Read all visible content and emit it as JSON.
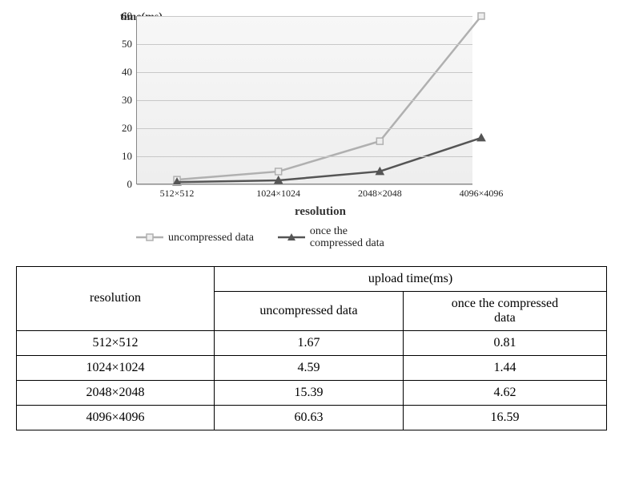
{
  "chart_data": {
    "type": "line",
    "title": "",
    "xlabel": "resolution",
    "ylabel": "time(ms)",
    "categories": [
      "512×512",
      "1024×1024",
      "2048×2048",
      "4096×4096"
    ],
    "series": [
      {
        "name": "uncompressed data",
        "values": [
          1.67,
          4.59,
          15.39,
          60.63
        ],
        "marker": "square",
        "color": "#b0b0b0"
      },
      {
        "name": "once the compressed data",
        "values": [
          0.81,
          1.44,
          4.62,
          16.59
        ],
        "marker": "triangle",
        "color": "#555"
      }
    ],
    "ylim": [
      0,
      60
    ],
    "yticks": [
      0,
      10,
      20,
      30,
      40,
      50,
      60
    ]
  },
  "table": {
    "header_group": "upload time(ms)",
    "row_header": "resolution",
    "columns": [
      "uncompressed data",
      "once the compressed data"
    ],
    "rows": [
      {
        "label": "512×512",
        "values": [
          "1.67",
          "0.81"
        ]
      },
      {
        "label": "1024×1024",
        "values": [
          "4.59",
          "1.44"
        ]
      },
      {
        "label": "2048×2048",
        "values": [
          "15.39",
          "4.62"
        ]
      },
      {
        "label": "4096×4096",
        "values": [
          "60.63",
          "16.59"
        ]
      }
    ]
  }
}
